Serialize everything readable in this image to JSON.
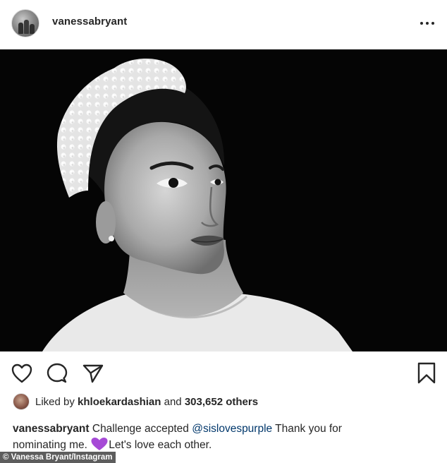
{
  "header": {
    "username": "vanessabryant",
    "more_icon": "more-horizontal-icon"
  },
  "photo": {
    "description_icon": "portrait-photo"
  },
  "actions": {
    "like_icon": "heart-outline-icon",
    "comment_icon": "comment-bubble-icon",
    "share_icon": "paper-plane-icon",
    "save_icon": "bookmark-icon"
  },
  "likes": {
    "prefix": "Liked by ",
    "user": "khloekardashian",
    "middle": " and ",
    "count": "303,652 others"
  },
  "caption": {
    "username": "vanessabryant",
    "text_1": " Challenge accepted ",
    "mention": "@sislovespurple",
    "text_2": " Thank you for nominating me. ",
    "text_3": "Let's love each other.",
    "emoji": "purple-heart"
  },
  "credit": {
    "text": "© Vanessa Bryant/Instagram"
  },
  "colors": {
    "text": "#262626",
    "mention": "#00376b",
    "emoji": "#a64ad6",
    "credit_bg": "#5d5d5d"
  }
}
